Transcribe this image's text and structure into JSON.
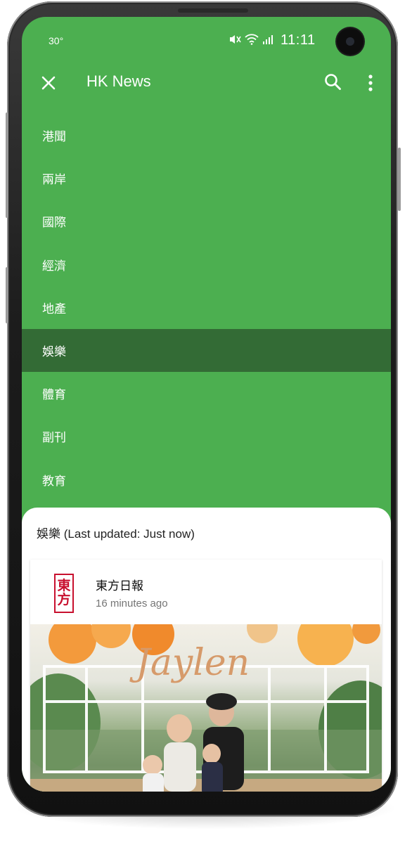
{
  "status_bar": {
    "temperature": "30°",
    "time": "11:11"
  },
  "app_bar": {
    "title": "HK News",
    "icons": [
      "close-icon",
      "search-icon",
      "more-vert-icon"
    ]
  },
  "menu": {
    "items": [
      {
        "label": "港聞"
      },
      {
        "label": "兩岸"
      },
      {
        "label": "國際"
      },
      {
        "label": "經濟"
      },
      {
        "label": "地產"
      },
      {
        "label": "娛樂",
        "active": true
      },
      {
        "label": "體育"
      },
      {
        "label": "副刊"
      },
      {
        "label": "教育"
      }
    ]
  },
  "sheet": {
    "header": "娛樂 (Last updated: Just now)",
    "card": {
      "source": "東方日報",
      "logo_text": [
        "東",
        "方"
      ],
      "time_ago": "16 minutes ago",
      "photo_caption": "Jaylen"
    }
  },
  "colors": {
    "primary": "#4caf50",
    "active_item": "#336b35",
    "logo_red": "#c8102e"
  }
}
